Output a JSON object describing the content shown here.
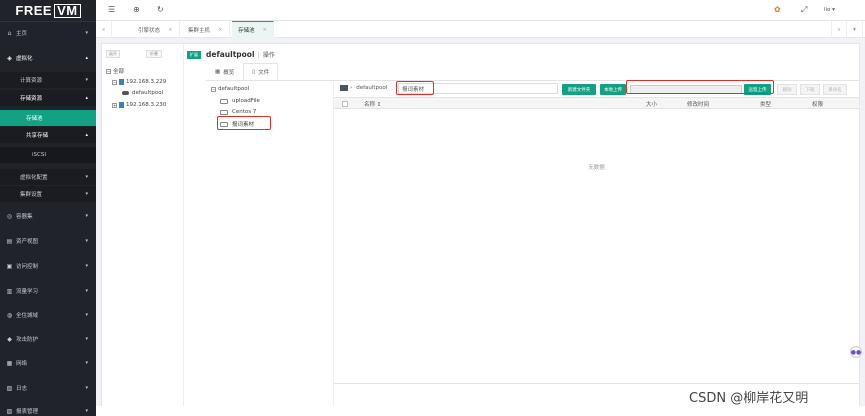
{
  "logo": {
    "text_free": "FREE",
    "text_vm": "VM"
  },
  "sidebar": {
    "items": [
      {
        "label": "主页",
        "icon": "home-icon"
      },
      {
        "label": "虚拟化",
        "icon": "stack-icon"
      },
      {
        "label": "计算资源"
      },
      {
        "label": "存储资源"
      },
      {
        "label": "存储池"
      },
      {
        "label": "共享存储"
      },
      {
        "label": "iSCSI"
      },
      {
        "label": "虚拟化配置"
      },
      {
        "label": "集群设置"
      },
      {
        "label": "容器集",
        "icon": "container-icon"
      },
      {
        "label": "资产视图",
        "icon": "asset-icon"
      },
      {
        "label": "访问控制",
        "icon": "lock-icon"
      },
      {
        "label": "流量学习",
        "icon": "flow-icon"
      },
      {
        "label": "全住城域",
        "icon": "globe-icon"
      },
      {
        "label": "攻击防护",
        "icon": "shield-icon"
      },
      {
        "label": "网络",
        "icon": "network-icon"
      },
      {
        "label": "日志",
        "icon": "log-icon"
      },
      {
        "label": "报表管理",
        "icon": "report-icon"
      }
    ]
  },
  "topbar": {
    "user": "lio ▾",
    "icons": [
      "menu-icon",
      "globe-icon",
      "refresh-icon",
      "palette-icon",
      "fullscreen-icon"
    ]
  },
  "tabs": [
    {
      "label": "引擎状态"
    },
    {
      "label": "集群主机"
    },
    {
      "label": "存储池"
    }
  ],
  "tree": {
    "btn_expand": "展开",
    "btn_collapse": "折叠",
    "root": "全部",
    "nodes": [
      {
        "label": "192.168.3.229"
      },
      {
        "label": "defaultpool"
      },
      {
        "label": "192.168.3.230"
      }
    ]
  },
  "header": {
    "badge": "扩展",
    "title": "defaultpool",
    "op": "操作"
  },
  "subtabs": [
    {
      "label": "概览"
    },
    {
      "label": "文件"
    }
  ],
  "folders": {
    "root": "defaultpool",
    "children": [
      "uploadFile",
      "Centos 7",
      "报词素材"
    ]
  },
  "file_panel": {
    "path_root": "defaultpool",
    "path_input": "报词素材",
    "btn_new_folder": "新建文件夹",
    "btn_local_upload": "本地上传",
    "btn_remote_upload": "远程上传",
    "btn_delete": "删除",
    "btn_download": "下载",
    "btn_rename": "重命名",
    "columns": [
      "名称 ↕",
      "大小",
      "修改时间",
      "类型",
      "权限"
    ],
    "empty": "无数据"
  },
  "watermark": "CSDN @柳岸花又明",
  "colors": {
    "accent": "#12a182",
    "sidebar": "#20232a",
    "highlight": "#e0302a"
  }
}
